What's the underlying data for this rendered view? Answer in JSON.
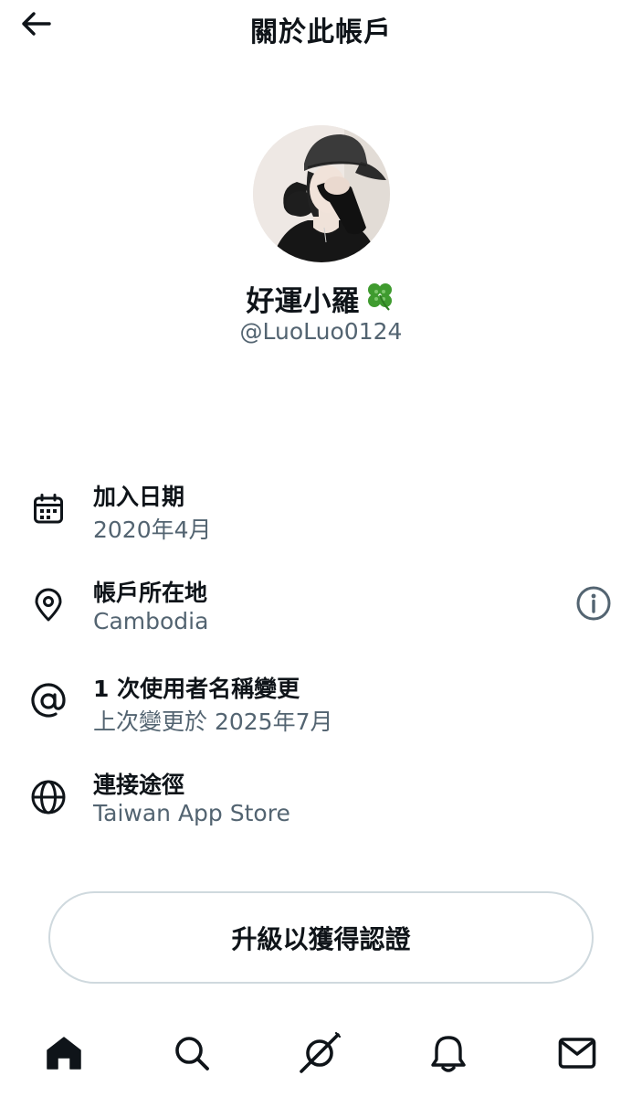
{
  "header": {
    "title": "關於此帳戶",
    "back_icon": "arrow-left-icon"
  },
  "profile": {
    "display_name": "好運小羅",
    "name_emoji": "🍀",
    "handle": "@LuoLuo0124"
  },
  "info": [
    {
      "icon": "calendar-icon",
      "title": "加入日期",
      "value": "2020年4月"
    },
    {
      "icon": "location-pin-icon",
      "title": "帳戶所在地",
      "value": "Cambodia"
    },
    {
      "icon": "at-sign-icon",
      "title": "1 次使用者名稱變更",
      "value": "上次變更於 2025年7月"
    },
    {
      "icon": "globe-icon",
      "title": "連接途徑",
      "value": "Taiwan App Store"
    }
  ],
  "info_detail_icon": "info-circle-icon",
  "upgrade_button": {
    "label": "升級以獲得認證"
  },
  "tab_bar": [
    {
      "name": "home",
      "icon": "home-icon",
      "active": true
    },
    {
      "name": "search",
      "icon": "search-icon"
    },
    {
      "name": "grok",
      "icon": "grok-icon"
    },
    {
      "name": "notifications",
      "icon": "bell-icon"
    },
    {
      "name": "messages",
      "icon": "mail-icon"
    }
  ],
  "colors": {
    "text_primary": "#0f1419",
    "text_secondary": "#536471",
    "border": "#cfd9de",
    "background": "#ffffff"
  }
}
